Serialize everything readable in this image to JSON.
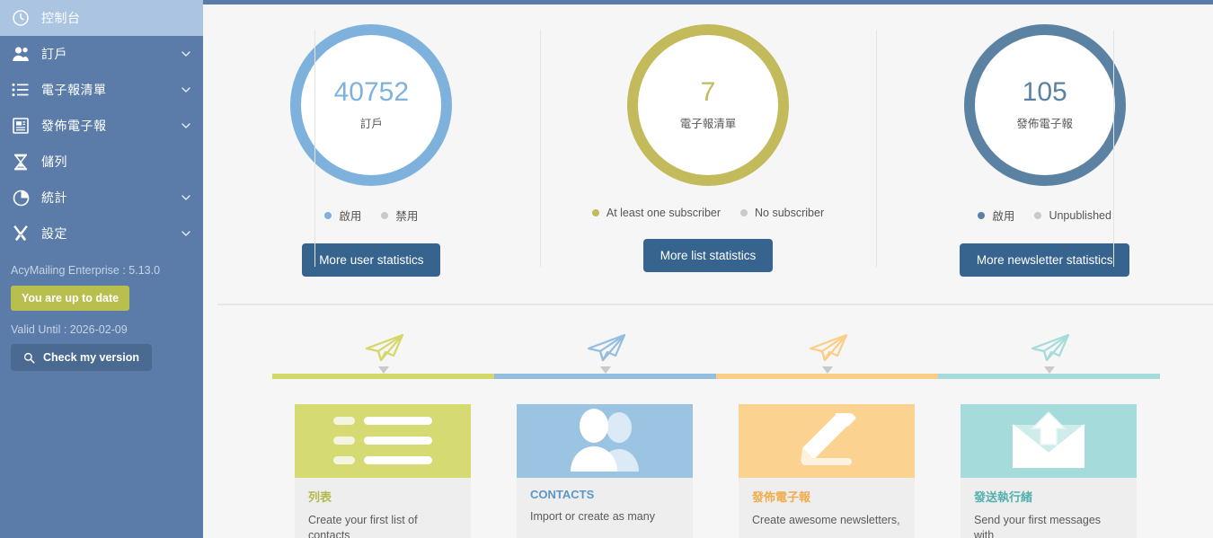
{
  "sidebar": {
    "items": [
      {
        "label": "控制台",
        "icon": "dashboard-icon",
        "active": true,
        "caret": false
      },
      {
        "label": "訂戶",
        "icon": "users-icon",
        "active": false,
        "caret": true
      },
      {
        "label": "電子報清單",
        "icon": "list-icon",
        "active": false,
        "caret": true
      },
      {
        "label": "發佈電子報",
        "icon": "newsletter-icon",
        "active": false,
        "caret": true
      },
      {
        "label": "儲列",
        "icon": "hourglass-icon",
        "active": false,
        "caret": false
      },
      {
        "label": "統計",
        "icon": "pie-chart-icon",
        "active": false,
        "caret": true
      },
      {
        "label": "設定",
        "icon": "tools-icon",
        "active": false,
        "caret": true
      }
    ],
    "footer": {
      "version_line": "AcyMailing Enterprise : 5.13.0",
      "update_badge": "You are up to date",
      "valid_until": "Valid Until : 2026-02-09",
      "check_version_label": "Check my version",
      "check_version_icon": "search-icon"
    },
    "colors": {
      "bg": "#5b7ca8",
      "active_bg": "#aac4e2",
      "badge": "#b8bf4f",
      "button": "#4b6a92"
    }
  },
  "stats": [
    {
      "name": "subscribers",
      "value": "40752",
      "caption": "訂戶",
      "ring_color": "#7eb2dd",
      "legend": [
        {
          "label": "啟用",
          "active": true
        },
        {
          "label": "禁用",
          "active": false
        }
      ],
      "button_label": "More user statistics"
    },
    {
      "name": "lists",
      "value": "7",
      "caption": "電子報清單",
      "ring_color": "#c3ba5c",
      "legend": [
        {
          "label": "At least one subscriber",
          "active": true
        },
        {
          "label": "No subscriber",
          "active": false
        }
      ],
      "button_label": "More list statistics"
    },
    {
      "name": "newsletters",
      "value": "105",
      "caption": "發佈電子報",
      "ring_color": "#5b82a3",
      "legend": [
        {
          "label": "啟用",
          "active": true
        },
        {
          "label": "Unpublished",
          "active": false
        }
      ],
      "button_label": "More newsletter statistics"
    }
  ],
  "timeline": {
    "segments": [
      {
        "color": "#d4d86a"
      },
      {
        "color": "#93bee0"
      },
      {
        "color": "#fbce87"
      },
      {
        "color": "#a5dcdb"
      }
    ]
  },
  "cards": [
    {
      "title": "列表",
      "title_color": "#b3b84f",
      "head_color": "#d6da72",
      "icon": "bullet-list-icon",
      "desc": "Create your first list of contacts"
    },
    {
      "title": "CONTACTS",
      "title_color": "#5b96c9",
      "head_color": "#9bc4e2",
      "icon": "contacts-icon",
      "desc": "Import or create as many"
    },
    {
      "title": "發佈電子報",
      "title_color": "#f0ac4d",
      "head_color": "#fbd28f",
      "icon": "pencil-icon",
      "desc": "Create awesome newsletters,"
    },
    {
      "title": "發送執行緒",
      "title_color": "#52b0ae",
      "head_color": "#a5dcdb",
      "icon": "send-mail-icon",
      "desc": "Send your first messages with"
    }
  ]
}
